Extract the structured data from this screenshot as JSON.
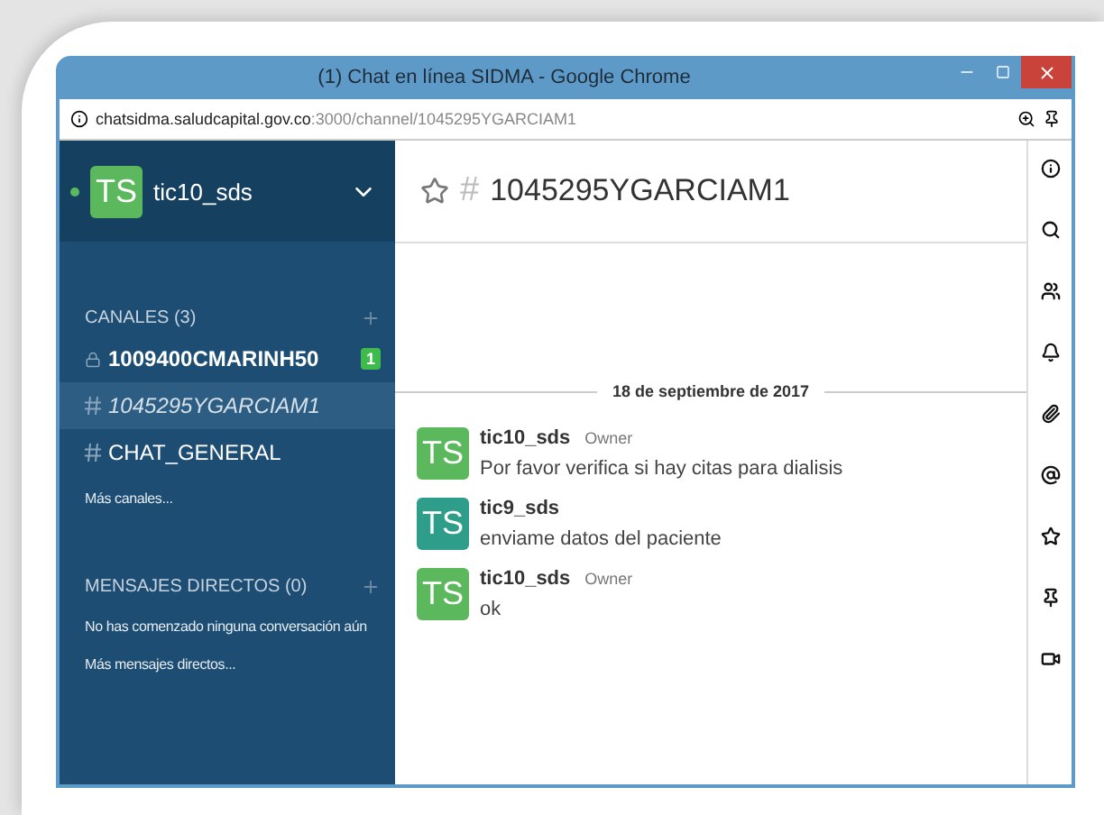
{
  "window": {
    "title": "(1) Chat en línea SIDMA - Google Chrome"
  },
  "address_bar": {
    "host": "chatsidma.saludcapital.gov.co",
    "path": ":3000/channel/1045295YGARCIAM1"
  },
  "user": {
    "initials": "TS",
    "name": "tic10_sds",
    "online": true
  },
  "channels_section": {
    "title": "CANALES (3)",
    "items": [
      {
        "kind": "lock",
        "name": "1009400CMARINH50",
        "selected": false,
        "unread": "1"
      },
      {
        "kind": "hash",
        "name": "1045295YGARCIAM1",
        "selected": true
      },
      {
        "kind": "hash",
        "name": "CHAT_GENERAL",
        "selected": false
      }
    ],
    "more": "Más canales..."
  },
  "direct_section": {
    "title": "MENSAJES DIRECTOS (0)",
    "empty": "No has comenzado ninguna conversación aún",
    "more": "Más mensajes directos..."
  },
  "channel_header": {
    "hash": "#",
    "title": "1045295YGARCIAM1",
    "favorite": false
  },
  "date_divider": "18 de septiembre de 2017",
  "messages": [
    {
      "initials": "TS",
      "color": "#5cb85c",
      "user": "tic10_sds",
      "role": "Owner",
      "text": "Por favor verifica si hay citas para dialisis"
    },
    {
      "initials": "TS",
      "color": "#2e9e8a",
      "user": "tic9_sds",
      "text": "enviame datos del paciente"
    },
    {
      "initials": "TS",
      "color": "#5cb85c",
      "user": "tic10_sds",
      "role": "Owner",
      "text": "ok"
    }
  ],
  "toolbar": [
    {
      "kind": "info"
    },
    {
      "kind": "search"
    },
    {
      "kind": "users"
    },
    {
      "kind": "bell"
    },
    {
      "kind": "clip"
    },
    {
      "kind": "at"
    },
    {
      "kind": "star"
    },
    {
      "kind": "pin"
    },
    {
      "kind": "video"
    }
  ]
}
